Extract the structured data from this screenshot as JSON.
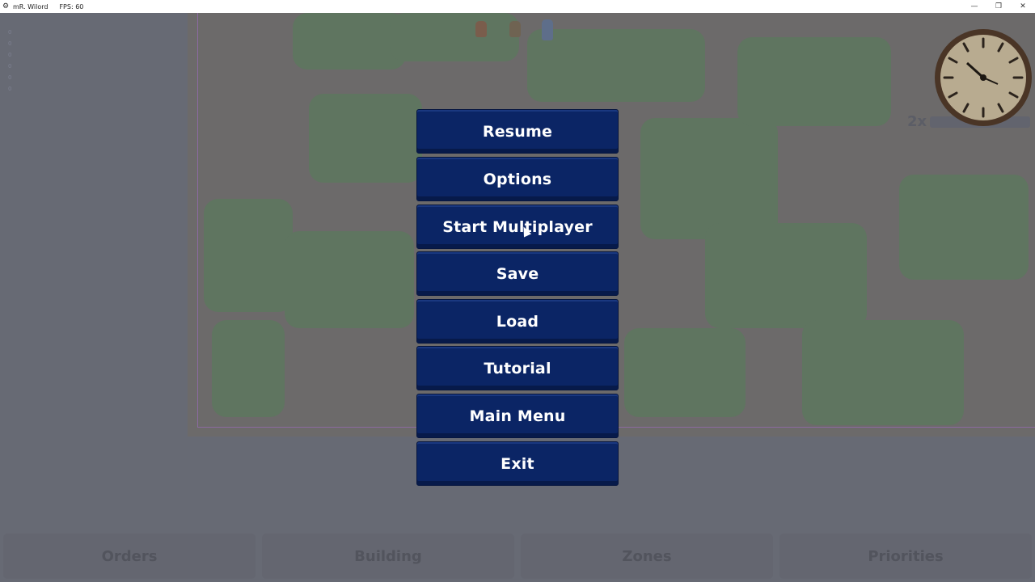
{
  "window": {
    "title": "mR. Wilord",
    "fps": "FPS: 60",
    "minimize": "—",
    "restore": "❐",
    "close": "✕"
  },
  "hud": {
    "speed": "2x",
    "side_gauge": [
      "0",
      "0",
      "0",
      "0",
      "0",
      "0"
    ]
  },
  "menu": {
    "buttons": [
      "Resume",
      "Options",
      "Start Multiplayer",
      "Save",
      "Load",
      "Tutorial",
      "Main Menu",
      "Exit"
    ]
  },
  "bottom_tabs": [
    "Orders",
    "Building",
    "Zones",
    "Priorities"
  ],
  "colors": {
    "menu_button": "#0b2565",
    "menu_text": "#ffffff",
    "overlay": "#6b6e78"
  },
  "icons": {
    "clock": "clock-icon",
    "app": "app-icon",
    "cursor": "mouse-cursor-icon"
  }
}
